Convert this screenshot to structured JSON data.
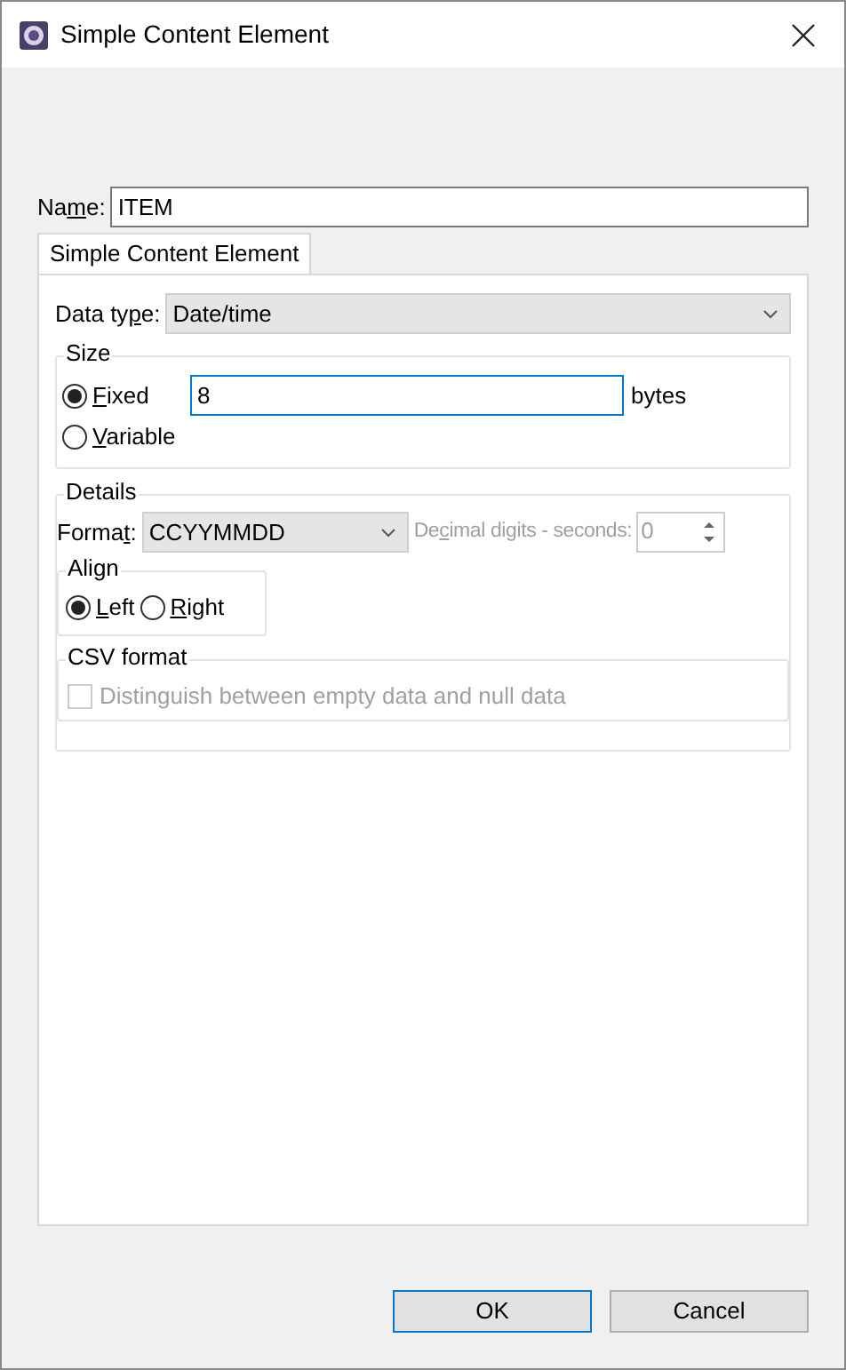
{
  "window": {
    "title": "Simple Content Element"
  },
  "name_field": {
    "label_parts": {
      "pre": "Na",
      "key": "m",
      "post": "e:"
    },
    "value": "ITEM"
  },
  "tabs": [
    {
      "label": "Simple Content Element",
      "selected": true
    }
  ],
  "data_type": {
    "label_parts": {
      "pre": "Data ty",
      "key": "p",
      "post": "e:"
    },
    "value": "Date/time"
  },
  "size": {
    "title": "Size",
    "options": [
      {
        "label_parts": {
          "key": "F",
          "post": "ixed"
        },
        "selected": true
      },
      {
        "label_parts": {
          "key": "V",
          "post": "ariable"
        },
        "selected": false
      }
    ],
    "value": "8",
    "unit": "bytes"
  },
  "details": {
    "title": "Details",
    "format": {
      "label_parts": {
        "pre": "Forma",
        "key": "t",
        "post": ":"
      },
      "value": "CCYYMMDD"
    },
    "decimal_digits": {
      "label_parts": {
        "pre": "De",
        "key": "c",
        "post": "imal digits - seconds:"
      },
      "value": "0",
      "disabled": true
    },
    "align": {
      "title": "Align",
      "options": [
        {
          "label_parts": {
            "key": "L",
            "post": "eft"
          },
          "selected": true
        },
        {
          "label_parts": {
            "key": "R",
            "post": "ight"
          },
          "selected": false
        }
      ]
    },
    "csv": {
      "title": "CSV format",
      "checkbox": {
        "label": "Distinguish between empty data and null data",
        "checked": false,
        "disabled": true
      }
    }
  },
  "buttons": [
    {
      "label": "OK",
      "default": true
    },
    {
      "label": "Cancel",
      "default": false
    }
  ]
}
